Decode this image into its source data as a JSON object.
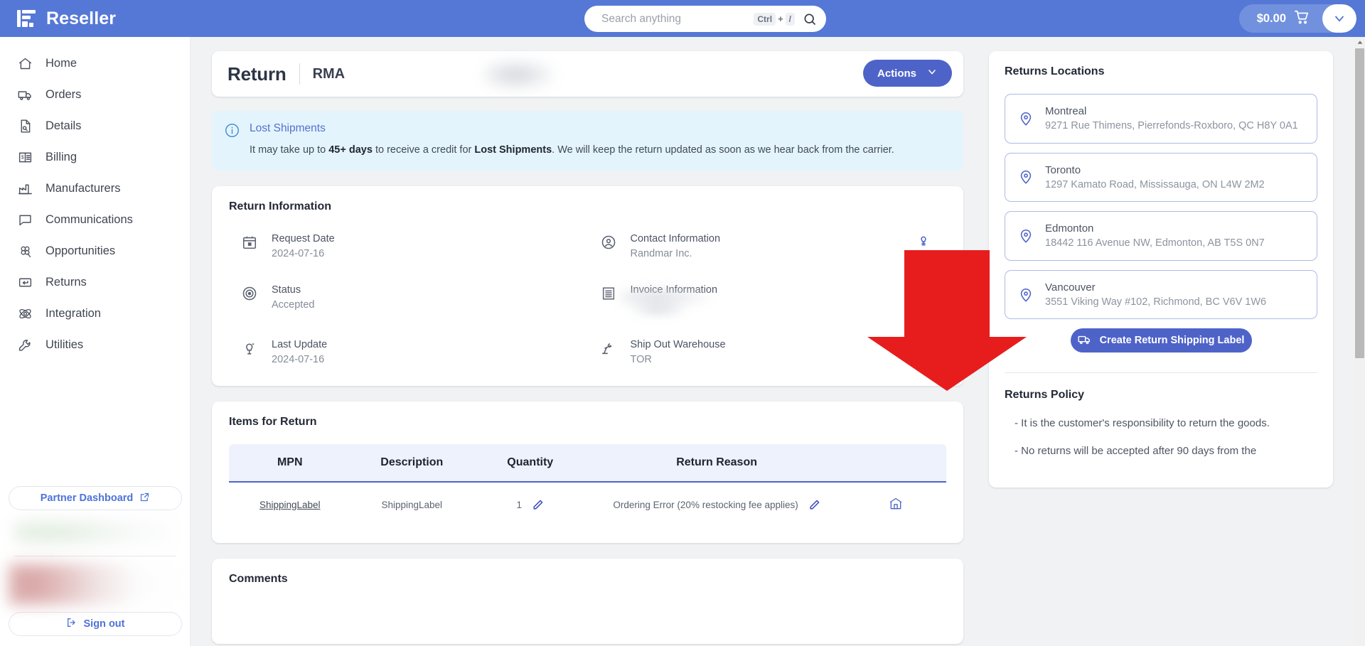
{
  "brand": {
    "name": "Reseller",
    "logo_icon": "reseller-logo-icon"
  },
  "search": {
    "placeholder": "Search anything",
    "value": "",
    "kbd_mod": "Ctrl",
    "kbd_plus": "+",
    "kbd_key": "/",
    "icon": "search-icon"
  },
  "cart": {
    "amount": "$0.00",
    "icon": "cart-icon",
    "caret_icon": "chevron-down-icon"
  },
  "sidebar": {
    "items": [
      {
        "label": "Home",
        "icon": "home-icon"
      },
      {
        "label": "Orders",
        "icon": "truck-icon"
      },
      {
        "label": "Details",
        "icon": "document-search-icon"
      },
      {
        "label": "Billing",
        "icon": "billing-icon"
      },
      {
        "label": "Manufacturers",
        "icon": "factory-icon"
      },
      {
        "label": "Communications",
        "icon": "chat-bubble-icon"
      },
      {
        "label": "Opportunities",
        "icon": "clover-icon"
      },
      {
        "label": "Returns",
        "icon": "return-arrow-icon"
      },
      {
        "label": "Integration",
        "icon": "integration-icon"
      },
      {
        "label": "Utilities",
        "icon": "wrench-icon"
      }
    ],
    "partner_dashboard": {
      "label": "Partner Dashboard",
      "icon": "external-link-icon"
    },
    "sign_out": {
      "label": "Sign out",
      "icon": "sign-out-icon"
    }
  },
  "header": {
    "title": "Return",
    "subtitle": "RMA",
    "actions_label": "Actions",
    "actions_caret_icon": "chevron-down-icon"
  },
  "alert": {
    "icon": "info-circle-icon",
    "title": "Lost Shipments",
    "body_1": "It may take up to ",
    "body_bold_1": "45+ days",
    "body_2": " to receive a credit for ",
    "body_bold_2": "Lost Shipments",
    "body_3": ". We will keep the return updated as soon as we hear back from the carrier."
  },
  "return_information": {
    "title": "Return Information",
    "fields": [
      {
        "label": "Request Date",
        "value": "2024-07-16",
        "icon": "calendar-icon"
      },
      {
        "label": "Contact Information",
        "value": "Randmar Inc.",
        "icon": "user-circle-icon",
        "bulb": "lightbulb-icon"
      },
      {
        "label": "Status",
        "value": "Accepted",
        "icon": "target-icon"
      },
      {
        "label": "Invoice Information",
        "value": "",
        "icon": "invoice-icon",
        "bulb": "lightbulb-icon"
      },
      {
        "label": "Last Update",
        "value": "2024-07-16",
        "icon": "lightbulb-sparkle-icon"
      },
      {
        "label": "Ship Out Warehouse",
        "value": "TOR",
        "icon": "robot-arm-icon"
      }
    ]
  },
  "items_for_return": {
    "title": "Items for Return",
    "columns": [
      "MPN",
      "Description",
      "Quantity",
      "Return Reason",
      ""
    ],
    "rows": [
      {
        "mpn": "ShippingLabel",
        "description": "ShippingLabel",
        "quantity": "1",
        "quantity_edit_icon": "pencil-icon",
        "return_reason": "Ordering Error (20% restocking fee applies)",
        "reason_edit_icon": "pencil-icon",
        "action_icon": "archive-box-icon"
      }
    ]
  },
  "comments": {
    "title": "Comments"
  },
  "returns_locations": {
    "title": "Returns Locations",
    "pin_icon": "map-pin-icon",
    "locations": [
      {
        "name": "Montreal",
        "address": "9271 Rue Thimens, Pierrefonds-Roxboro, QC H8Y 0A1"
      },
      {
        "name": "Toronto",
        "address": "1297 Kamato Road, Mississauga, ON L4W 2M2"
      },
      {
        "name": "Edmonton",
        "address": "18442 116 Avenue NW, Edmonton, AB T5S 0N7"
      },
      {
        "name": "Vancouver",
        "address": "3551 Viking Way #102, Richmond, BC V6V 1W6"
      }
    ],
    "create_label_button": {
      "label": "Create Return Shipping Label",
      "icon": "shipping-truck-icon"
    }
  },
  "returns_policy": {
    "title": "Returns Policy",
    "lines": [
      "- It is the customer's responsibility to return the goods.",
      "- No returns will be accepted after 90 days from the"
    ]
  },
  "overlay": {
    "arrow_icon": "red-down-arrow-icon",
    "arrow_color": "#e71d1d"
  },
  "scrollbar": {
    "up_arrow_icon": "scroll-up-icon",
    "down_arrow_icon": "scroll-down-icon"
  },
  "colors": {
    "brand_blue": "#5578d6",
    "accent": "#4e63c8",
    "alert_bg": "#e4f4fc",
    "page_bg": "#f1f2f4"
  }
}
